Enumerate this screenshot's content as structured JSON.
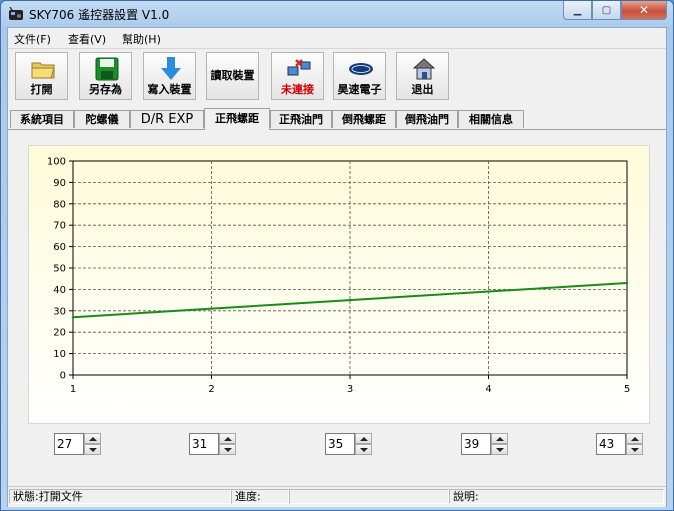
{
  "window": {
    "title": "SKY706 遙控器設置 V1.0"
  },
  "menu": [
    {
      "label": "文件(F)"
    },
    {
      "label": "查看(V)"
    },
    {
      "label": "幫助(H)"
    }
  ],
  "toolbar": [
    {
      "label": "打開",
      "icon": "folder-icon"
    },
    {
      "label": "另存為",
      "icon": "floppy-disk-icon"
    },
    {
      "label": "寫入裝置",
      "icon": "down-arrow-icon"
    },
    {
      "label": "讀取裝置",
      "icon": "none"
    },
    {
      "label": "未連接",
      "icon": "connection-icon",
      "color": "#d00000"
    },
    {
      "label": "昊速電子",
      "icon": "skyartec-logo-icon"
    },
    {
      "label": "退出",
      "icon": "house-exit-icon"
    }
  ],
  "tabs": [
    {
      "label": "系統項目"
    },
    {
      "label": "陀螺儀"
    },
    {
      "label": "D/R EXP"
    },
    {
      "label": "正飛螺距",
      "selected": true
    },
    {
      "label": "正飛油門"
    },
    {
      "label": "倒飛螺距"
    },
    {
      "label": "倒飛油門"
    },
    {
      "label": "相關信息"
    }
  ],
  "chart_data": {
    "type": "line",
    "x": [
      1,
      2,
      3,
      4,
      5
    ],
    "series": [
      {
        "values": [
          27,
          31,
          35,
          39,
          43
        ],
        "color": "#1a8a1a"
      }
    ],
    "xlim": [
      1,
      5
    ],
    "ylim": [
      0,
      100
    ],
    "yticks": [
      0,
      10,
      20,
      30,
      40,
      50,
      60,
      70,
      80,
      90,
      100
    ],
    "xticks": [
      1,
      2,
      3,
      4,
      5
    ],
    "grid": true
  },
  "points": [
    {
      "value": "27"
    },
    {
      "value": "31"
    },
    {
      "value": "35"
    },
    {
      "value": "39"
    },
    {
      "value": "43"
    }
  ],
  "status": {
    "state": "狀態:打開文件",
    "progress": "進度:",
    "description": "說明:"
  }
}
